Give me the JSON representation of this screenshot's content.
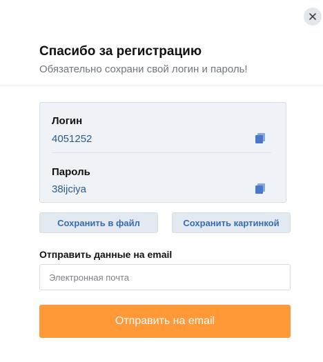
{
  "modal": {
    "title": "Спасибо за регистрацию",
    "subtitle": "Обязательно сохрани свой логин и пароль!",
    "close_icon": "close-icon"
  },
  "credentials": {
    "login": {
      "label": "Логин",
      "value": "4051252",
      "icon": "copy-icon"
    },
    "password": {
      "label": "Пароль",
      "value": "38ijciya",
      "icon": "copy-icon"
    }
  },
  "actions": {
    "save_file_label": "Сохранить в файл",
    "save_image_label": "Сохранить картинкой"
  },
  "email": {
    "label": "Отправить данные на email",
    "placeholder": "Электронная почта",
    "value": ""
  },
  "submit": {
    "label": "Отправить на email"
  },
  "colors": {
    "accent": "#ff9836",
    "link": "#3a6bb0",
    "value_text": "#2a5a8a",
    "copy_icon": "#4a78c8"
  }
}
